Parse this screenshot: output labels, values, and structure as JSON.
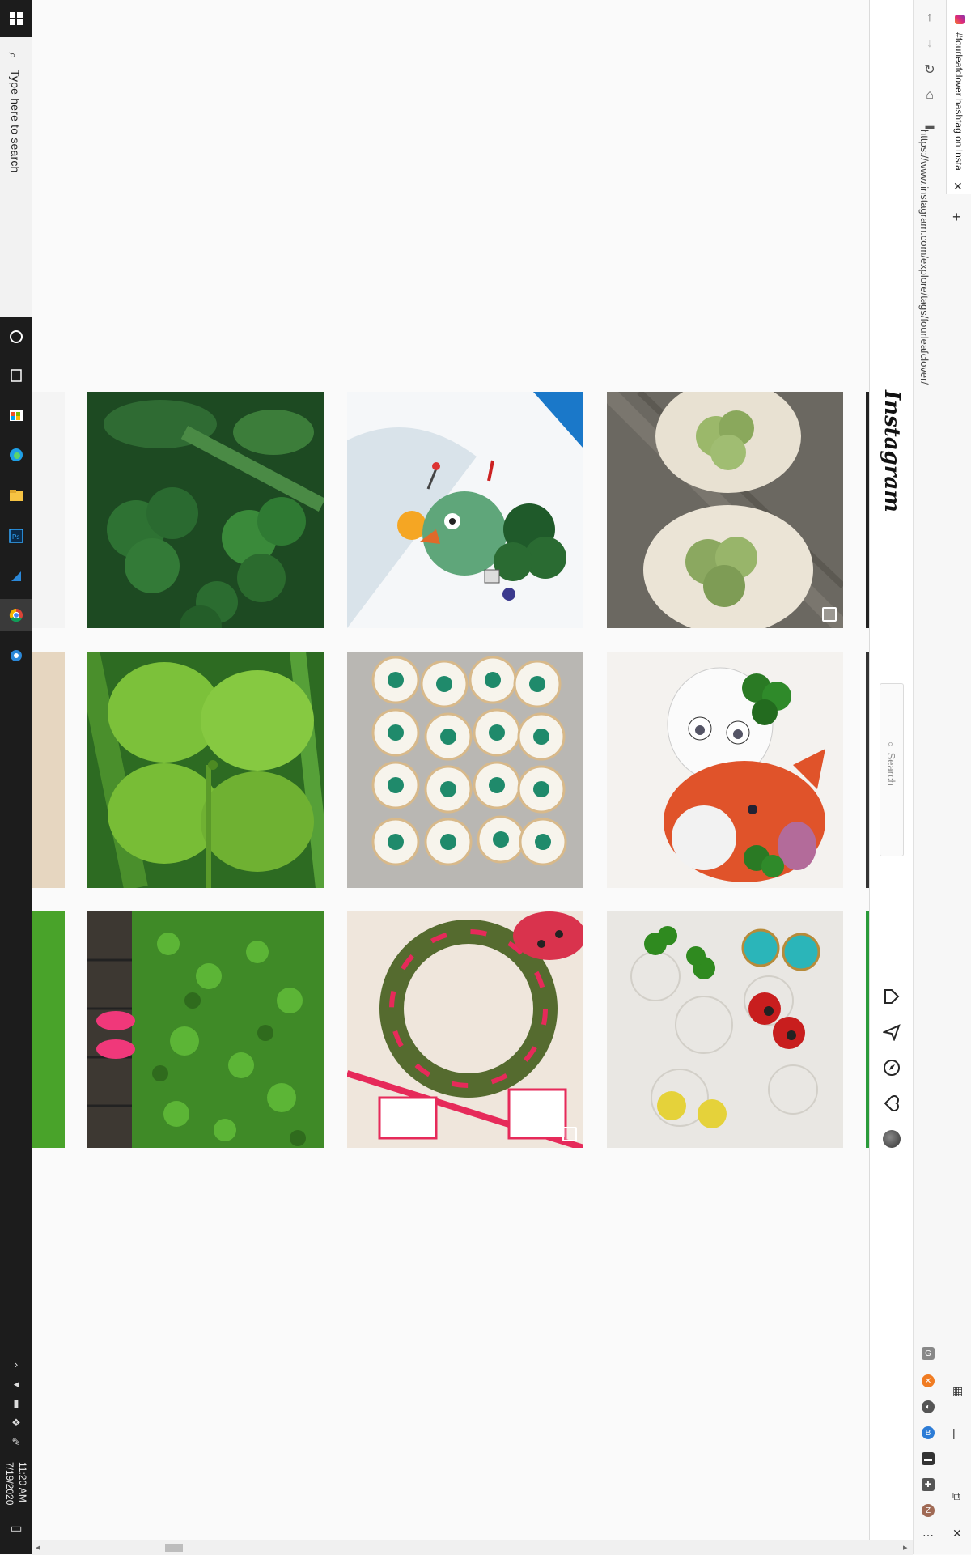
{
  "taskbar": {
    "search_placeholder": "Type here to search",
    "clock_time": "11:20 AM",
    "clock_date": "7/19/2020",
    "pinned_icons": [
      "cortana-icon",
      "task-view-icon",
      "store-icon",
      "edge-icon",
      "file-explorer-icon",
      "photoshop-icon",
      "ink-icon",
      "chrome-icon",
      "settings-icon"
    ]
  },
  "browser": {
    "tab_title": "#fourleafclover hashtag on Insta",
    "url": "https://www.instagram.com/explore/tags/fourleafclover/",
    "nav": [
      "back-icon",
      "forward-icon",
      "reload-icon",
      "home-icon"
    ]
  },
  "instagram": {
    "logo": "Instagram",
    "search_placeholder": "Search",
    "nav_icons": [
      "home-icon",
      "direct-icon",
      "explore-icon",
      "activity-icon",
      "profile-avatar"
    ]
  },
  "grid": {
    "rows": [
      {
        "tiles": [
          "partial-left",
          "clover-leaves-droplets",
          "ceramic-robot-clover",
          "clover-ceramic-slices"
        ]
      },
      {
        "tiles": [
          "partial-left",
          "four-leaf-clover-closeup",
          "clover-cookies",
          "fox-figurine-clover"
        ]
      },
      {
        "tiles": [
          "partial-left",
          "pink-shoes-clover-patch",
          "red-ribbon-wreath",
          "enamel-earrings"
        ]
      }
    ]
  }
}
